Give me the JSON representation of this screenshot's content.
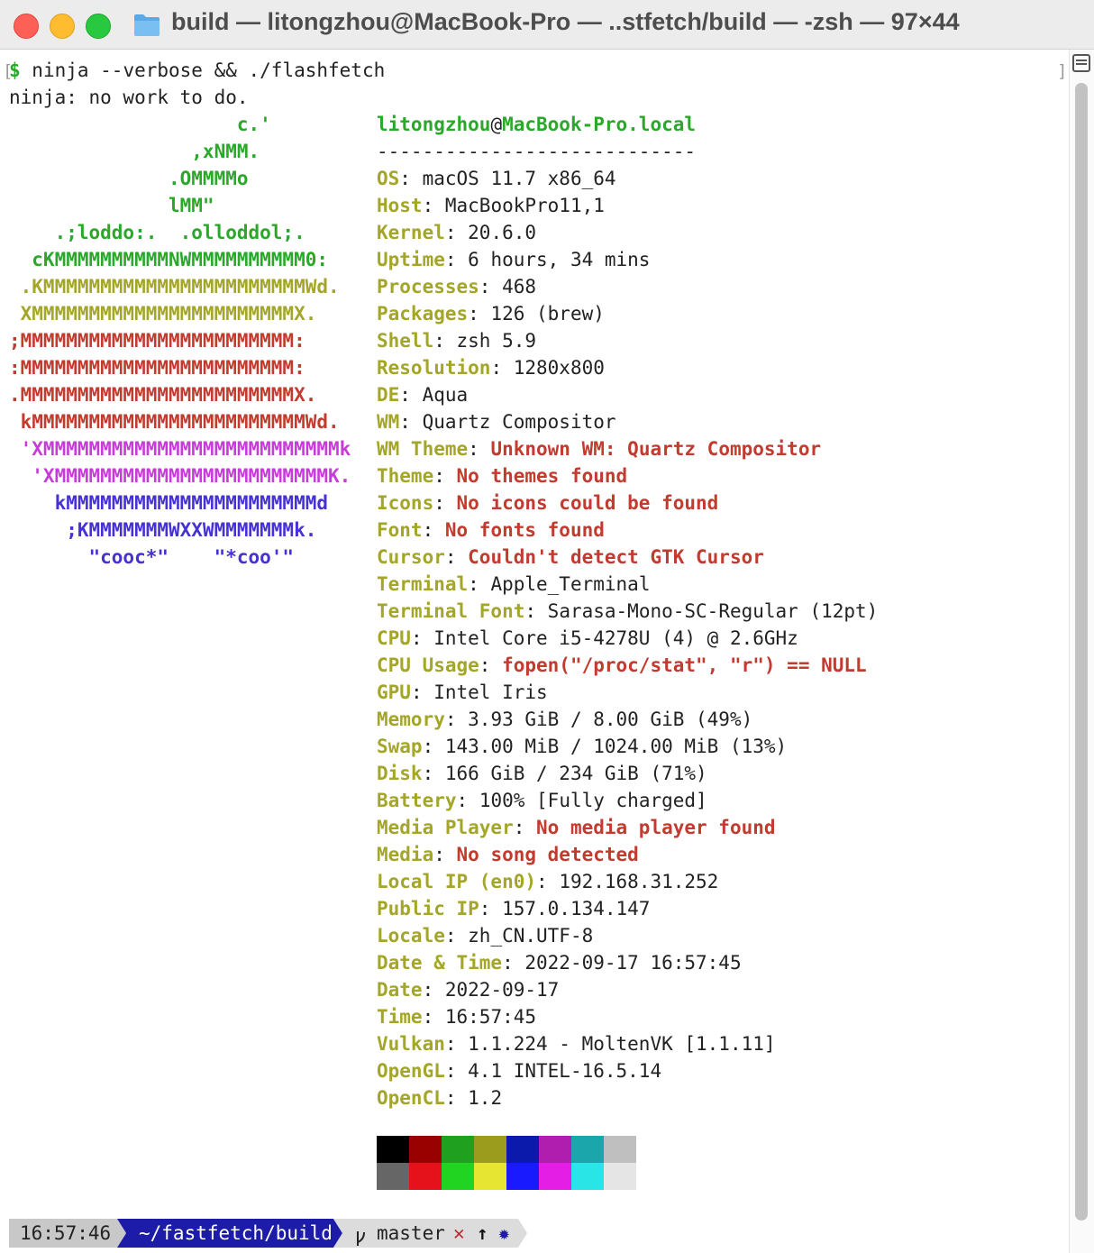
{
  "window": {
    "title": "build — litongzhou@MacBook-Pro — ..stfetch/build — -zsh — 97×44",
    "buttons": [
      "close",
      "minimize",
      "zoom"
    ],
    "icon": "folder-icon"
  },
  "terminal": {
    "prompt_symbol": "$",
    "command": " ninja --verbose && ./flashfetch",
    "ninja_output": "ninja: no work to do.",
    "logo": [
      {
        "text": "                    c.'",
        "color": "green"
      },
      {
        "text": "                ,xNMM.",
        "color": "green"
      },
      {
        "text": "              .OMMMMo",
        "color": "green"
      },
      {
        "text": "              lMM\"",
        "color": "green"
      },
      {
        "text": "    .;loddo:.  .olloddol;.",
        "color": "green"
      },
      {
        "text": "  cKMMMMMMMMMMNWMMMMMMMMMM0:",
        "color": "green"
      },
      {
        "text": " .KMMMMMMMMMMMMMMMMMMMMMMMWd.",
        "color": "olive"
      },
      {
        "text": " XMMMMMMMMMMMMMMMMMMMMMMMX.",
        "color": "olive"
      },
      {
        "text": ";MMMMMMMMMMMMMMMMMMMMMMMM:",
        "color": "red"
      },
      {
        "text": ":MMMMMMMMMMMMMMMMMMMMMMMM:",
        "color": "red"
      },
      {
        "text": ".MMMMMMMMMMMMMMMMMMMMMMMMX.",
        "color": "red"
      },
      {
        "text": " kMMMMMMMMMMMMMMMMMMMMMMMMWd.",
        "color": "red"
      },
      {
        "text": " 'XMMMMMMMMMMMMMMMMMMMMMMMMMMk",
        "color": "magenta"
      },
      {
        "text": "  'XMMMMMMMMMMMMMMMMMMMMMMMMK.",
        "color": "magenta"
      },
      {
        "text": "    kMMMMMMMMMMMMMMMMMMMMMMd",
        "color": "blue"
      },
      {
        "text": "     ;KMMMMMMMWXXWMMMMMMMk.",
        "color": "blue"
      },
      {
        "text": "       \"cooc*\"    \"*coo'\"",
        "color": "blue"
      }
    ],
    "header": {
      "user": "litongzhou",
      "at": "@",
      "host": "MacBook-Pro.local",
      "separator": "----------------------------"
    },
    "info": [
      {
        "key": "OS",
        "value": "macOS 11.7 x86_64",
        "error": false
      },
      {
        "key": "Host",
        "value": "MacBookPro11,1",
        "error": false
      },
      {
        "key": "Kernel",
        "value": "20.6.0",
        "error": false
      },
      {
        "key": "Uptime",
        "value": "6 hours, 34 mins",
        "error": false
      },
      {
        "key": "Processes",
        "value": "468",
        "error": false
      },
      {
        "key": "Packages",
        "value": "126 (brew)",
        "error": false
      },
      {
        "key": "Shell",
        "value": "zsh 5.9",
        "error": false
      },
      {
        "key": "Resolution",
        "value": "1280x800",
        "error": false
      },
      {
        "key": "DE",
        "value": "Aqua",
        "error": false
      },
      {
        "key": "WM",
        "value": "Quartz Compositor",
        "error": false
      },
      {
        "key": "WM Theme",
        "value": "Unknown WM: Quartz Compositor",
        "error": true
      },
      {
        "key": "Theme",
        "value": "No themes found",
        "error": true
      },
      {
        "key": "Icons",
        "value": "No icons could be found",
        "error": true
      },
      {
        "key": "Font",
        "value": "No fonts found",
        "error": true
      },
      {
        "key": "Cursor",
        "value": "Couldn't detect GTK Cursor",
        "error": true
      },
      {
        "key": "Terminal",
        "value": "Apple_Terminal",
        "error": false
      },
      {
        "key": "Terminal Font",
        "value": "Sarasa-Mono-SC-Regular (12pt)",
        "error": false
      },
      {
        "key": "CPU",
        "value": "Intel Core i5-4278U (4) @ 2.6GHz",
        "error": false
      },
      {
        "key": "CPU Usage",
        "value": "fopen(\"/proc/stat\", \"r\") == NULL",
        "error": true
      },
      {
        "key": "GPU",
        "value": "Intel Iris",
        "error": false
      },
      {
        "key": "Memory",
        "value": "3.93 GiB / 8.00 GiB (49%)",
        "error": false
      },
      {
        "key": "Swap",
        "value": "143.00 MiB / 1024.00 MiB (13%)",
        "error": false
      },
      {
        "key": "Disk",
        "value": "166 GiB / 234 GiB (71%)",
        "error": false
      },
      {
        "key": "Battery",
        "value": "100% [Fully charged]",
        "error": false
      },
      {
        "key": "Media Player",
        "value": "No media player found",
        "error": true
      },
      {
        "key": "Media",
        "value": "No song detected",
        "error": true
      },
      {
        "key": "Local IP (en0)",
        "value": "192.168.31.252",
        "error": false
      },
      {
        "key": "Public IP",
        "value": "157.0.134.147",
        "error": false
      },
      {
        "key": "Locale",
        "value": "zh_CN.UTF-8",
        "error": false
      },
      {
        "key": "Date & Time",
        "value": "2022-09-17 16:57:45",
        "error": false
      },
      {
        "key": "Date",
        "value": "2022-09-17",
        "error": false
      },
      {
        "key": "Time",
        "value": "16:57:45",
        "error": false
      },
      {
        "key": "Vulkan",
        "value": "1.1.224 - MoltenVK [1.1.11]",
        "error": false
      },
      {
        "key": "OpenGL",
        "value": "4.1 INTEL-16.5.14",
        "error": false
      },
      {
        "key": "OpenCL",
        "value": "1.2",
        "error": false
      }
    ],
    "palette": {
      "normal": [
        "#000000",
        "#990000",
        "#1fa11f",
        "#9b9b1e",
        "#0b1aab",
        "#b01eb0",
        "#1aa6aa",
        "#bfbfbf"
      ],
      "bright": [
        "#666666",
        "#e5121b",
        "#22d422",
        "#e5e532",
        "#1a1aff",
        "#e51ee5",
        "#2ae5e5",
        "#e5e5e5"
      ]
    }
  },
  "prompt": {
    "time": "16:57:46",
    "path": "~/fastfetch/build",
    "branch_icon": "git-branch-icon",
    "branch": "master",
    "status_icons": [
      "✕",
      "↑",
      "✹"
    ]
  },
  "colors": {
    "green": "#2aa82a",
    "olive": "#a3a628",
    "red": "#c23b2f",
    "magenta": "#c73cd8",
    "blue": "#4632d4",
    "prompt_time_bg": "#c8c8c8",
    "prompt_path_bg": "#1c1ca8",
    "prompt_git_bg": "#dcdcdc"
  }
}
